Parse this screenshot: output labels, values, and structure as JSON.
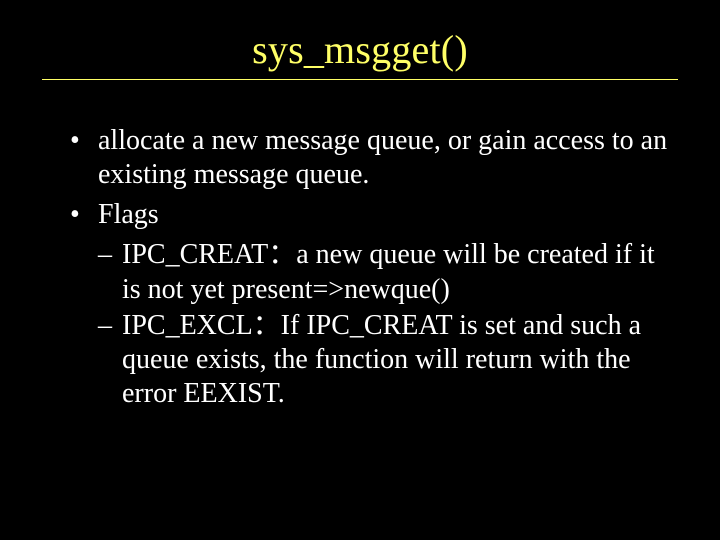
{
  "title": "sys_msgget()",
  "bullets": {
    "b1": "allocate a new message queue, or gain access to an existing message queue.",
    "b2": "Flags",
    "b2a": "IPC_CREAT：a new queue will be created if it is not yet present=>newque()",
    "b2b": "IPC_EXCL：If IPC_CREAT is set and such a queue exists, the function will return with the error EEXIST."
  }
}
